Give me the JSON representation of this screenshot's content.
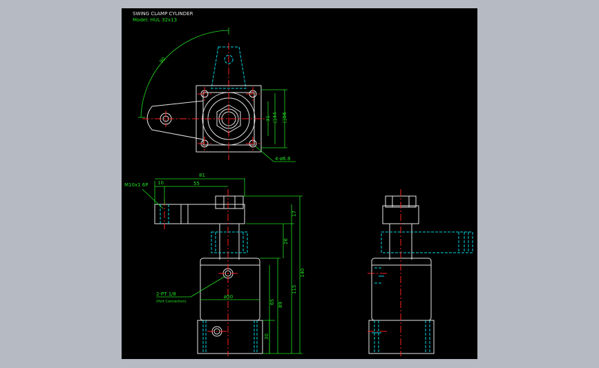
{
  "drawing": {
    "title": "SWING CLAMP CYLINDER",
    "model": "Model: HUL 32x13"
  },
  "dimensions": {
    "r_arc": "90",
    "d31": "31",
    "d44": "□44",
    "d56": "□56",
    "holes": "4-ø6.8",
    "d81": "81",
    "d10": "10",
    "d55": "55",
    "thread": "M10x1 6P",
    "d17": "17",
    "d26": "26",
    "d140": "140",
    "d115": "115",
    "d89": "89",
    "d65": "65",
    "d30": "30",
    "dia50": "ø50"
  },
  "annotations": {
    "port": "2-PT 1/8",
    "port_note": "(Port Connection)"
  },
  "colors": {
    "background": "#000000",
    "outline": "#e8e8e8",
    "hidden": "#00d8e8",
    "center": "#ff2020",
    "dimension": "#22e022",
    "viewport": "#b6bac3"
  }
}
